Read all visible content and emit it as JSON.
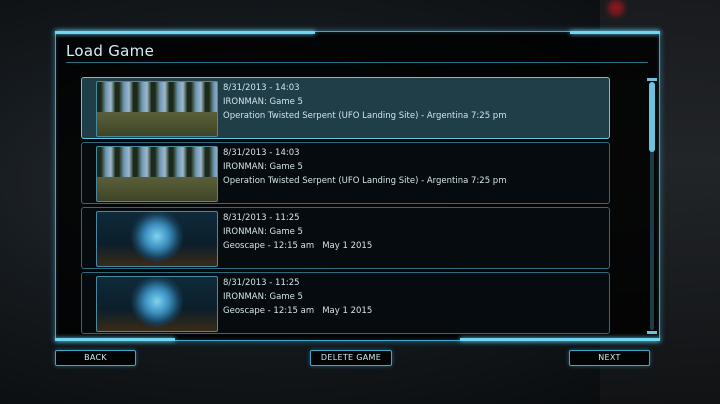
{
  "window": {
    "title": "Load Game"
  },
  "saves": [
    {
      "date": "8/31/2013 - 14:03",
      "game": "IRONMAN: Game 5",
      "location": "Operation Twisted Serpent (UFO Landing Site) - Argentina 7:25 pm",
      "thumbnail": "forest-landing-site"
    },
    {
      "date": "8/31/2013 - 14:03",
      "game": "IRONMAN: Game 5",
      "location": "Operation Twisted Serpent (UFO Landing Site) - Argentina 7:25 pm",
      "thumbnail": "forest-landing-site"
    },
    {
      "date": "8/31/2013 - 11:25",
      "game": "IRONMAN: Game 5",
      "location": "Geoscape - 12:15 am   May 1 2015",
      "thumbnail": "geoscape-globe"
    },
    {
      "date": "8/31/2013 - 11:25",
      "game": "IRONMAN: Game 5",
      "location": "Geoscape - 12:15 am   May 1 2015",
      "thumbnail": "geoscape-globe"
    }
  ],
  "selected_index": 0,
  "buttons": {
    "back": "BACK",
    "delete": "DELETE GAME",
    "next": "NEXT"
  },
  "colors": {
    "accent": "#3ea6c8",
    "selected_row": "#1f3e48"
  }
}
